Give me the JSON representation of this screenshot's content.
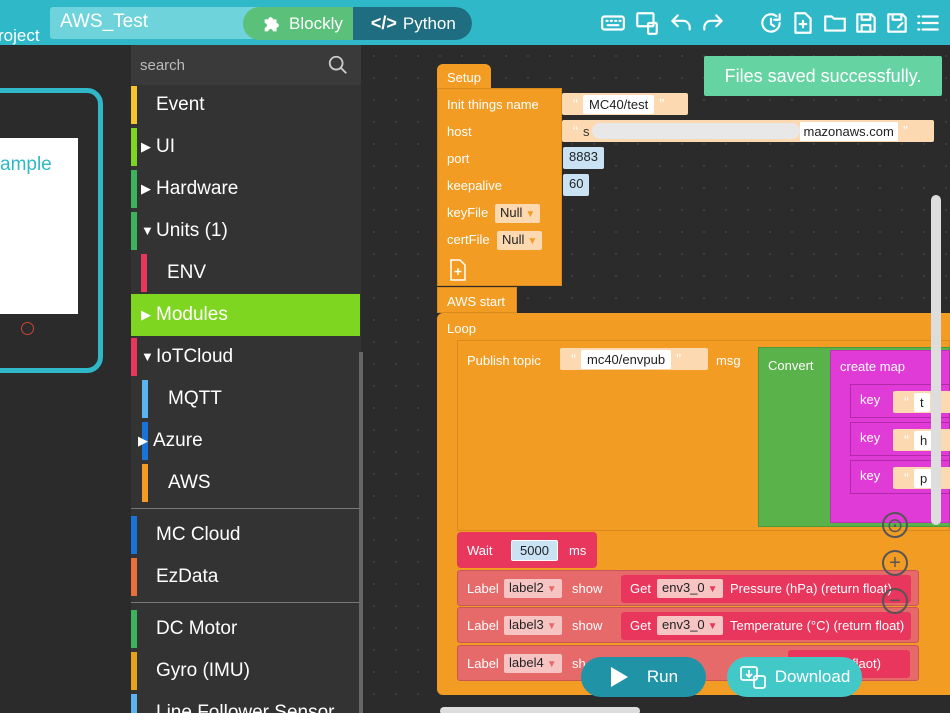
{
  "header": {
    "brand_text": "roject",
    "project_name": "AWS_Test",
    "mode_blockly": "Blockly",
    "mode_python": "Python"
  },
  "preview": {
    "sample_text": "ample"
  },
  "sidebar": {
    "search_placeholder": "search",
    "items": [
      {
        "label": "Event",
        "color": "#f7c42e"
      },
      {
        "label": "UI",
        "color": "#7fd621"
      },
      {
        "label": "Hardware",
        "color": "#3cb35c"
      },
      {
        "label": "Units (1)",
        "color": "#3cb35c"
      },
      {
        "label": "ENV",
        "color": "#e8365d"
      },
      {
        "label": "Modules",
        "color": "#7fd621"
      },
      {
        "label": "IoTCloud",
        "color": "#e8365d"
      },
      {
        "label": "MQTT",
        "color": "#5ab4f0"
      },
      {
        "label": "Azure",
        "color": "#1a73d6"
      },
      {
        "label": "AWS",
        "color": "#f39c24"
      },
      {
        "label": "MC Cloud",
        "color": "#1a73d6"
      },
      {
        "label": "EzData",
        "color": "#e9703a"
      },
      {
        "label": "DC Motor",
        "color": "#3cb35c"
      },
      {
        "label": "Gyro (IMU)",
        "color": "#e8a21a"
      },
      {
        "label": "Line Follower Sensor",
        "color": "#5ab4f0"
      }
    ]
  },
  "blocks": {
    "setup_label": "Setup",
    "init_label": "Init things name",
    "init_value": "MC40/test",
    "host_label": "host",
    "host_value": "s",
    "host_value_end": "mazonaws.com",
    "port_label": "port",
    "port_value": "8883",
    "keepalive_label": "keepalive",
    "keepalive_value": "60",
    "keyfile_label": "keyFile",
    "keyfile_value": "Null",
    "certfile_label": "certFile",
    "certfile_value": "Null",
    "aws_start_label": "AWS start",
    "loop_label": "Loop",
    "publish_label": "Publish topic",
    "publish_value": "mc40/envpub",
    "msg_label": "msg",
    "convert_label": "Convert",
    "create_map_label": "create map",
    "key_label": "key",
    "key_values": [
      "t",
      "h",
      "p"
    ],
    "wait_label": "Wait",
    "wait_value": "5000",
    "ms_label": "ms",
    "label_rows": [
      {
        "label": "Label",
        "target": "label2",
        "show": "show",
        "get": "Get",
        "unit": "env3_0",
        "reading": "Pressure (hPa) (return float)"
      },
      {
        "label": "Label",
        "target": "label3",
        "show": "show",
        "get": "Get",
        "unit": "env3_0",
        "reading": "Temperature (°C) (return float)"
      },
      {
        "label": "Label",
        "target": "label4",
        "show": "sh",
        "get": "",
        "unit": "",
        "reading": "flaot)"
      }
    ]
  },
  "toast": "Files saved successfully.",
  "run_label": "Run",
  "download_label": "Download",
  "colors": {
    "accent": "#2fb8c8",
    "block_orange": "#f39c24",
    "block_green": "#5ab34a",
    "block_magenta": "#e03bd6",
    "block_red": "#e65a5a",
    "toast": "#66d4a2"
  }
}
